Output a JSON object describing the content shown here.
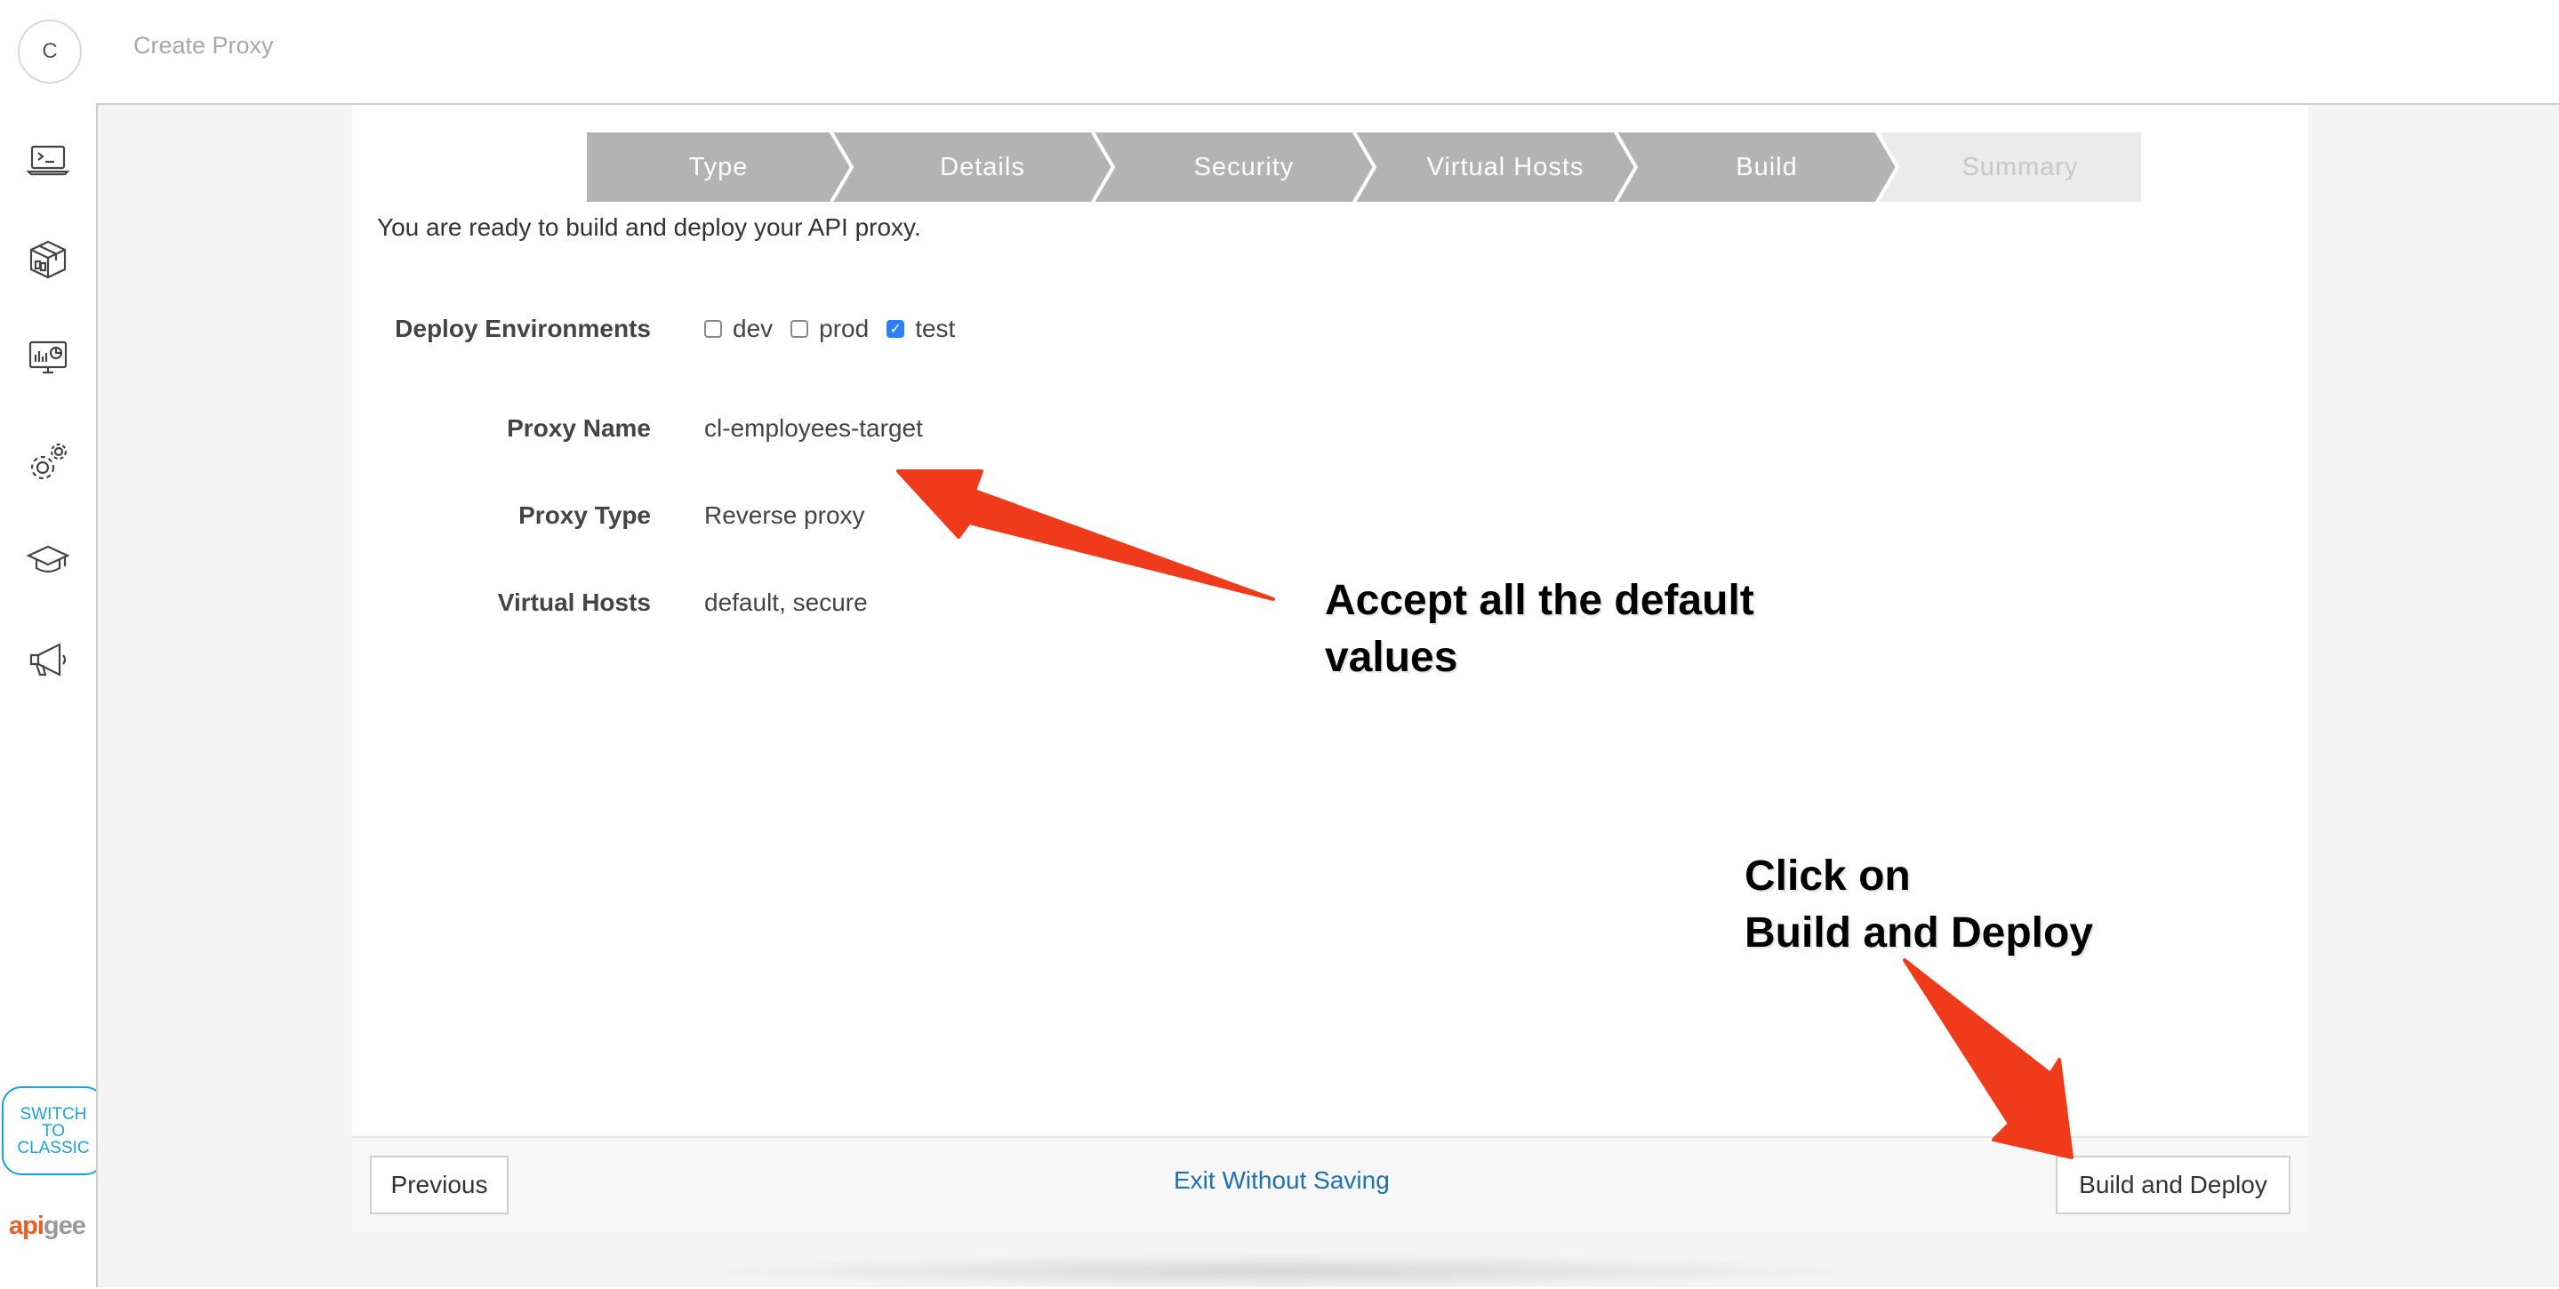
{
  "header": {
    "avatar_letter": "C",
    "title": "Create Proxy"
  },
  "sidebar": {
    "icons": [
      "terminal-icon",
      "package-icon",
      "analytics-monitor-icon",
      "gears-icon",
      "graduation-cap-icon",
      "megaphone-icon"
    ],
    "switch_line1": "SWITCH",
    "switch_line2": "TO",
    "switch_line3": "CLASSIC",
    "logo_a": "api",
    "logo_b": "gee"
  },
  "wizard": {
    "steps": [
      "Type",
      "Details",
      "Security",
      "Virtual Hosts",
      "Build",
      "Summary"
    ],
    "active_color": "#b3b3b3",
    "inactive_color": "#ebebeb"
  },
  "main": {
    "intro": "You are ready to build and deploy your API proxy.",
    "deploy_label": "Deploy Environments",
    "environments": [
      {
        "name": "dev",
        "checked": false
      },
      {
        "name": "prod",
        "checked": false
      },
      {
        "name": "test",
        "checked": true
      }
    ],
    "proxy_name_label": "Proxy Name",
    "proxy_name": "cl-employees-target",
    "proxy_type_label": "Proxy Type",
    "proxy_type": "Reverse proxy",
    "virtual_hosts_label": "Virtual Hosts",
    "virtual_hosts": "default, secure"
  },
  "footer": {
    "previous": "Previous",
    "exit": "Exit Without Saving",
    "build_deploy": "Build and Deploy"
  },
  "annotations": {
    "note1_line1": "Accept all the default",
    "note1_line2": "values",
    "note2_line1": "Click on",
    "note2_line2": "Build and Deploy",
    "arrow_color": "#f03a1c"
  }
}
